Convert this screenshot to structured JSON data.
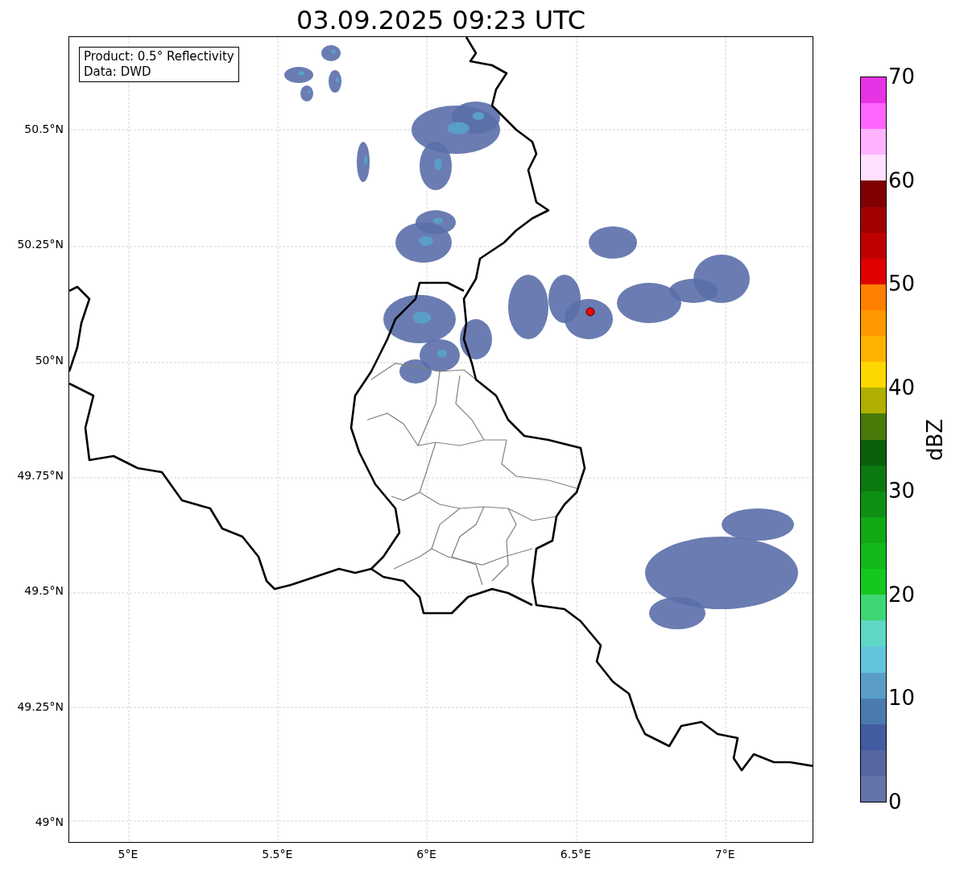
{
  "title": "03.09.2025 09:23 UTC",
  "map": {
    "legend": [
      "Product: 0.5° Reflectivity",
      "Data: DWD"
    ],
    "lat_labels": [
      "50.5°N",
      "50.25°N",
      "50°N",
      "49.75°N",
      "49.5°N",
      "49.25°N",
      "49°N"
    ],
    "lon_labels": [
      "5°E",
      "5.5°E",
      "6°E",
      "6.5°E",
      "7°E"
    ]
  },
  "colorbar": {
    "label": "dBZ",
    "ticks": [
      "70",
      "60",
      "50",
      "40",
      "30",
      "20",
      "10",
      "0"
    ],
    "bands": [
      {
        "color": "#e633e6"
      },
      {
        "color": "#ff66ff"
      },
      {
        "color": "#ffb3ff"
      },
      {
        "color": "#ffe0ff"
      },
      {
        "color": "#7f0000"
      },
      {
        "color": "#a00000"
      },
      {
        "color": "#c00000"
      },
      {
        "color": "#e00000"
      },
      {
        "color": "#ff7f00"
      },
      {
        "color": "#ff9900"
      },
      {
        "color": "#ffb300"
      },
      {
        "color": "#ffd700"
      },
      {
        "color": "#b0b000"
      },
      {
        "color": "#4a7a0a"
      },
      {
        "color": "#08600c"
      },
      {
        "color": "#0c7a10"
      },
      {
        "color": "#0e9014"
      },
      {
        "color": "#10a814"
      },
      {
        "color": "#12b81a"
      },
      {
        "color": "#14c81e"
      },
      {
        "color": "#3ed674"
      },
      {
        "color": "#5ed8c4"
      },
      {
        "color": "#64c4dc"
      },
      {
        "color": "#5a9ec8"
      },
      {
        "color": "#4a7ab0"
      },
      {
        "color": "#425ca2"
      },
      {
        "color": "#5566a0"
      },
      {
        "color": "#6474a8"
      }
    ]
  }
}
